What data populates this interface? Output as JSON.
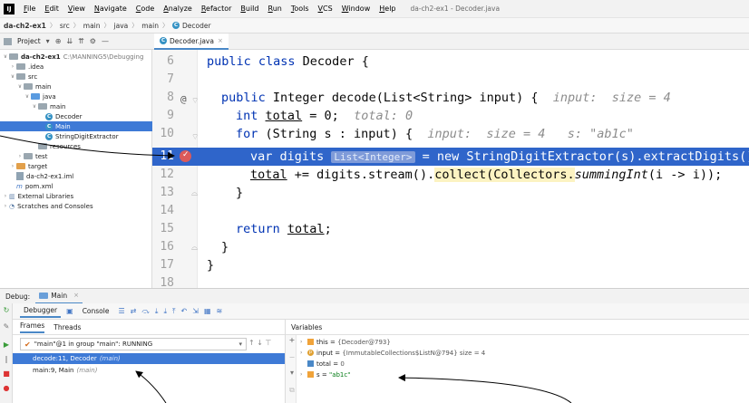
{
  "menubar": {
    "logo": "IJ",
    "items": [
      "File",
      "Edit",
      "View",
      "Navigate",
      "Code",
      "Analyze",
      "Refactor",
      "Build",
      "Run",
      "Tools",
      "VCS",
      "Window",
      "Help"
    ],
    "window_title": "da-ch2-ex1 - Decoder.java"
  },
  "breadcrumb": [
    "da-ch2-ex1",
    "src",
    "main",
    "java",
    "main",
    "Decoder"
  ],
  "project_panel": {
    "title": "Project",
    "tree": [
      {
        "label": "da-ch2-ex1",
        "path": "C:\\MANNING5\\Debugging",
        "depth": 0,
        "expanded": true,
        "kind": "module"
      },
      {
        "label": ".idea",
        "depth": 1,
        "expanded": false,
        "kind": "folder"
      },
      {
        "label": "src",
        "depth": 1,
        "expanded": true,
        "kind": "folder"
      },
      {
        "label": "main",
        "depth": 2,
        "expanded": true,
        "kind": "folder"
      },
      {
        "label": "java",
        "depth": 3,
        "expanded": true,
        "kind": "folder-blue"
      },
      {
        "label": "main",
        "depth": 4,
        "expanded": true,
        "kind": "folder"
      },
      {
        "label": "Decoder",
        "depth": 5,
        "kind": "class"
      },
      {
        "label": "Main",
        "depth": 5,
        "kind": "class",
        "selected": true
      },
      {
        "label": "StringDigitExtractor",
        "depth": 5,
        "kind": "class"
      },
      {
        "label": "resources",
        "depth": 3,
        "kind": "folder"
      },
      {
        "label": "test",
        "depth": 2,
        "expanded": false,
        "kind": "folder"
      },
      {
        "label": "target",
        "depth": 1,
        "expanded": false,
        "kind": "folder-orange"
      },
      {
        "label": "da-ch2-ex1.iml",
        "depth": 1,
        "kind": "file"
      },
      {
        "label": "pom.xml",
        "depth": 1,
        "kind": "maven"
      },
      {
        "label": "External Libraries",
        "depth": 0,
        "expanded": false,
        "kind": "library"
      },
      {
        "label": "Scratches and Consoles",
        "depth": 0,
        "expanded": false,
        "kind": "scratch"
      }
    ]
  },
  "editor": {
    "tab_label": "Decoder.java",
    "line_numbers": [
      "6",
      "7",
      "8",
      "9",
      "10",
      "11",
      "12",
      "13",
      "14",
      "15",
      "16",
      "17",
      "18"
    ],
    "lines": {
      "l6": {
        "kw": "public class",
        "rest": " Decoder {"
      },
      "l8": {
        "kw": "public",
        "mid": " Integer decode(List<String> input) {  ",
        "hint": "input:  size = 4"
      },
      "l9": {
        "kw": "int",
        "sp": " ",
        "var": "total",
        "mid": " = 0;  ",
        "hint": "total: 0"
      },
      "l10": {
        "kw": "for",
        "mid": " (String s : input) {  ",
        "hint": "input:  size = 4   s: \"ab1c\""
      },
      "l11": {
        "pre": "var digits ",
        "inlay": "List<Integer>",
        "post": " = new StringDigitExtractor(s).extractDigits();"
      },
      "l12": {
        "var": "total",
        "mid": " += digits.stream().",
        "collect": "collect(Collectors.",
        "ital": "summingInt",
        "post": "(i -> i));"
      },
      "l13": {
        "text": "}"
      },
      "l15": {
        "kw": "return",
        "sp": " ",
        "var": "total",
        "post": ";"
      },
      "l16": {
        "text": "}"
      },
      "l17": {
        "text": "}"
      }
    },
    "annotation_marker": "@"
  },
  "debug": {
    "title": "Debug:",
    "config_tab": "Main",
    "tabs": [
      "Debugger",
      "Console"
    ],
    "frames_tabs": [
      "Frames",
      "Threads"
    ],
    "thread_selector": "\"main\"@1 in group \"main\": RUNNING",
    "frames": [
      {
        "method": "decode:11, Decoder",
        "location": "(main)",
        "selected": true
      },
      {
        "method": "main:9, Main",
        "location": "(main)",
        "selected": false
      }
    ],
    "variables_title": "Variables",
    "variables": [
      {
        "name": "this",
        "value": "{Decoder@793}",
        "icon": "orange",
        "expandable": true
      },
      {
        "name": "input",
        "value": "{ImmutableCollections$ListN@794}  size = 4",
        "icon": "p",
        "expandable": true
      },
      {
        "name": "total",
        "value": "0",
        "icon": "blue",
        "expandable": false
      },
      {
        "name": "s",
        "value": "\"ab1c\"",
        "icon": "orange",
        "expandable": true
      }
    ]
  }
}
